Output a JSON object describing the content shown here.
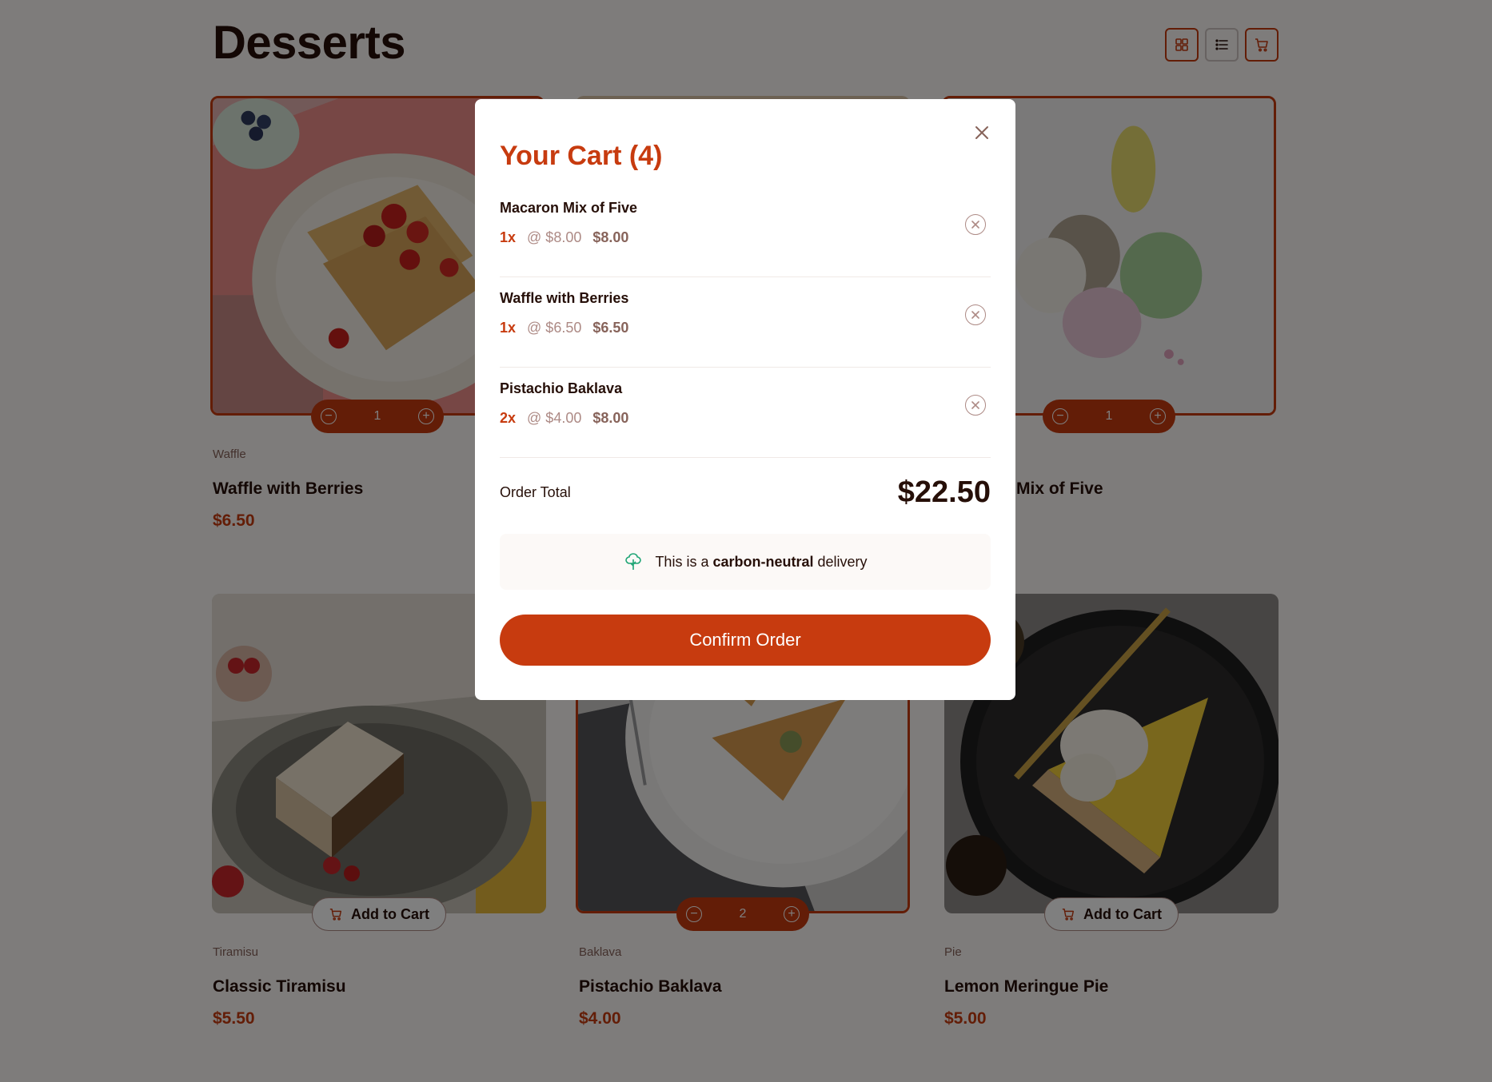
{
  "page": {
    "title": "Desserts",
    "toolbar": {
      "grid_icon": "grid-icon",
      "list_icon": "list-icon",
      "cart_icon": "cart-icon"
    }
  },
  "products": [
    {
      "category": "Waffle",
      "name": "Waffle with Berries",
      "price": "$6.50",
      "quantity": "1",
      "in_cart": true,
      "image": "waffle"
    },
    {
      "category": "",
      "name": "",
      "price": "",
      "quantity": "",
      "in_cart": false,
      "image": "creme-brulee-hidden"
    },
    {
      "category": "",
      "name": "Mix of Five",
      "price": "",
      "quantity": "1",
      "in_cart": true,
      "image": "macarons"
    },
    {
      "category": "Tiramisu",
      "name": "Classic Tiramisu",
      "price": "$5.50",
      "add_label": "Add to Cart",
      "in_cart": false,
      "image": "tiramisu"
    },
    {
      "category": "Baklava",
      "name": "Pistachio Baklava",
      "price": "$4.00",
      "quantity": "2",
      "in_cart": true,
      "image": "baklava"
    },
    {
      "category": "Pie",
      "name": "Lemon Meringue Pie",
      "price": "$5.00",
      "add_label": "Add to Cart",
      "in_cart": false,
      "image": "pie"
    }
  ],
  "modal": {
    "title": "Your Cart (4)",
    "items": [
      {
        "name": "Macaron Mix of Five",
        "qty": "1x",
        "unit": "@ $8.00",
        "total": "$8.00"
      },
      {
        "name": "Waffle with Berries",
        "qty": "1x",
        "unit": "@ $6.50",
        "total": "$6.50"
      },
      {
        "name": "Pistachio Baklava",
        "qty": "2x",
        "unit": "@ $4.00",
        "total": "$8.00"
      }
    ],
    "order_total_label": "Order Total",
    "order_total_value": "$22.50",
    "carbon_prefix": "This is a",
    "carbon_bold": "carbon-neutral",
    "carbon_suffix": "delivery",
    "confirm_label": "Confirm Order"
  },
  "colors": {
    "accent": "#c73b0f",
    "text_dark": "#260f08",
    "text_muted": "#87635a",
    "carbon_icon": "#1ea575"
  }
}
